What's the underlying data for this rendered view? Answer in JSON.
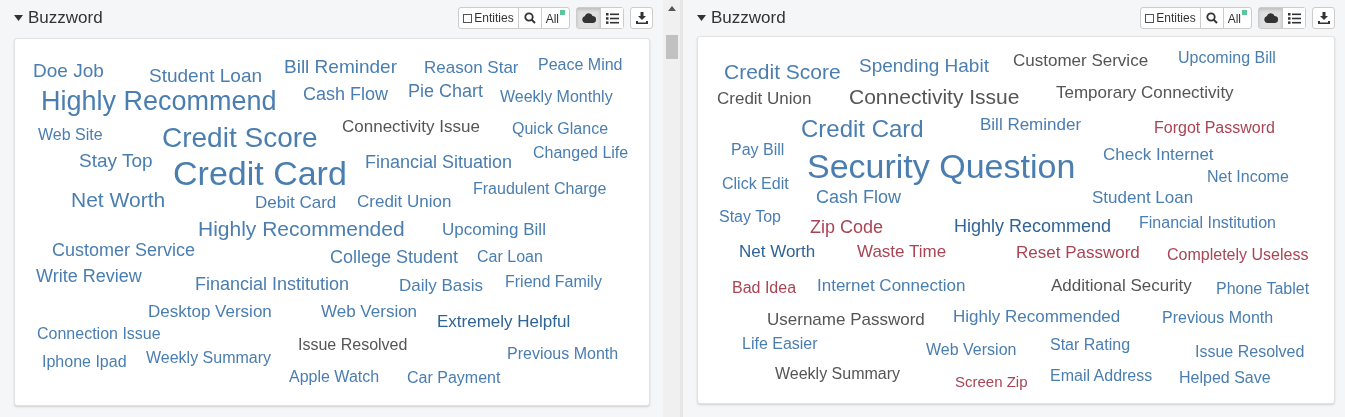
{
  "panels": [
    {
      "title": "Buzzword",
      "entities": {
        "label": "Entities",
        "checked": false
      },
      "scope": {
        "label": "All",
        "color": "#5cc59a"
      },
      "views": [
        {
          "kind": "cloud",
          "selected": true
        },
        {
          "kind": "list",
          "selected": false
        }
      ],
      "words": [
        {
          "text": "Doe Job",
          "color": "#4a7eb0"
        },
        {
          "text": "Student Loan",
          "color": "#4a7eb0"
        },
        {
          "text": "Bill Reminder",
          "color": "#4a7eb0"
        },
        {
          "text": "Reason Star",
          "color": "#4a7eb0"
        },
        {
          "text": "Peace Mind",
          "color": "#4a7eb0"
        },
        {
          "text": "Highly Recommend",
          "color": "#4a7eb0"
        },
        {
          "text": "Cash Flow",
          "color": "#4a7eb0"
        },
        {
          "text": "Pie Chart",
          "color": "#4a7eb0"
        },
        {
          "text": "Weekly Monthly",
          "color": "#4a7eb0"
        },
        {
          "text": "Web Site",
          "color": "#4a7eb0"
        },
        {
          "text": "Credit Score",
          "color": "#4a7eb0"
        },
        {
          "text": "Connectivity Issue",
          "color": "#555555"
        },
        {
          "text": "Quick Glance",
          "color": "#4a7eb0"
        },
        {
          "text": "Stay Top",
          "color": "#4a7eb0"
        },
        {
          "text": "Credit Card",
          "color": "#4a7eb0"
        },
        {
          "text": "Financial Situation",
          "color": "#4a7eb0"
        },
        {
          "text": "Changed Life",
          "color": "#4a7eb0"
        },
        {
          "text": "Net Worth",
          "color": "#4a7eb0"
        },
        {
          "text": "Debit Card",
          "color": "#4a7eb0"
        },
        {
          "text": "Credit Union",
          "color": "#4a7eb0"
        },
        {
          "text": "Fraudulent Charge",
          "color": "#4a7eb0"
        },
        {
          "text": "Highly Recommended",
          "color": "#4a7eb0"
        },
        {
          "text": "Upcoming Bill",
          "color": "#4a7eb0"
        },
        {
          "text": "Customer Service",
          "color": "#4a7eb0"
        },
        {
          "text": "College Student",
          "color": "#4a7eb0"
        },
        {
          "text": "Car Loan",
          "color": "#4a7eb0"
        },
        {
          "text": "Write Review",
          "color": "#4a7eb0"
        },
        {
          "text": "Financial Institution",
          "color": "#4a7eb0"
        },
        {
          "text": "Daily Basis",
          "color": "#4a7eb0"
        },
        {
          "text": "Friend Family",
          "color": "#4a7eb0"
        },
        {
          "text": "Desktop Version",
          "color": "#4a7eb0"
        },
        {
          "text": "Web Version",
          "color": "#4a7eb0"
        },
        {
          "text": "Extremely Helpful",
          "color": "#2f6496"
        },
        {
          "text": "Connection Issue",
          "color": "#4a7eb0"
        },
        {
          "text": "Issue Resolved",
          "color": "#555555"
        },
        {
          "text": "Previous Month",
          "color": "#4a7eb0"
        },
        {
          "text": "Iphone Ipad",
          "color": "#4a7eb0"
        },
        {
          "text": "Weekly Summary",
          "color": "#4a7eb0"
        },
        {
          "text": "Apple Watch",
          "color": "#4a7eb0"
        },
        {
          "text": "Car Payment",
          "color": "#4a7eb0"
        }
      ]
    },
    {
      "title": "Buzzword",
      "entities": {
        "label": "Entities",
        "checked": false
      },
      "scope": {
        "label": "All",
        "color": "#5cc59a"
      },
      "views": [
        {
          "kind": "cloud",
          "selected": true
        },
        {
          "kind": "list",
          "selected": false
        }
      ],
      "words": [
        {
          "text": "Credit Score",
          "color": "#4a7eb0"
        },
        {
          "text": "Spending Habit",
          "color": "#4a7eb0"
        },
        {
          "text": "Customer Service",
          "color": "#555555"
        },
        {
          "text": "Upcoming Bill",
          "color": "#4a7eb0"
        },
        {
          "text": "Credit Union",
          "color": "#555555"
        },
        {
          "text": "Connectivity Issue",
          "color": "#555555"
        },
        {
          "text": "Temporary Connectivity",
          "color": "#555555"
        },
        {
          "text": "Credit Card",
          "color": "#4a7eb0"
        },
        {
          "text": "Bill Reminder",
          "color": "#4a7eb0"
        },
        {
          "text": "Forgot Password",
          "color": "#a94455"
        },
        {
          "text": "Pay Bill",
          "color": "#4a7eb0"
        },
        {
          "text": "Security Question",
          "color": "#4a7eb0"
        },
        {
          "text": "Check Internet",
          "color": "#4a7eb0"
        },
        {
          "text": "Net Income",
          "color": "#4a7eb0"
        },
        {
          "text": "Click Edit",
          "color": "#4a7eb0"
        },
        {
          "text": "Cash Flow",
          "color": "#4a7eb0"
        },
        {
          "text": "Student Loan",
          "color": "#4a7eb0"
        },
        {
          "text": "Stay Top",
          "color": "#4a7eb0"
        },
        {
          "text": "Zip Code",
          "color": "#a94455"
        },
        {
          "text": "Highly Recommend",
          "color": "#2f6496"
        },
        {
          "text": "Financial Institution",
          "color": "#4a7eb0"
        },
        {
          "text": "Net Worth",
          "color": "#2f6496"
        },
        {
          "text": "Waste Time",
          "color": "#a94455"
        },
        {
          "text": "Reset Password",
          "color": "#a94455"
        },
        {
          "text": "Completely Useless",
          "color": "#a94455"
        },
        {
          "text": "Bad Idea",
          "color": "#a94455"
        },
        {
          "text": "Internet Connection",
          "color": "#4a7eb0"
        },
        {
          "text": "Additional Security",
          "color": "#555555"
        },
        {
          "text": "Phone Tablet",
          "color": "#4a7eb0"
        },
        {
          "text": "Username Password",
          "color": "#555555"
        },
        {
          "text": "Highly Recommended",
          "color": "#4a7eb0"
        },
        {
          "text": "Previous Month",
          "color": "#4a7eb0"
        },
        {
          "text": "Life Easier",
          "color": "#4a7eb0"
        },
        {
          "text": "Web Version",
          "color": "#4a7eb0"
        },
        {
          "text": "Star Rating",
          "color": "#4a7eb0"
        },
        {
          "text": "Issue Resolved",
          "color": "#4a7eb0"
        },
        {
          "text": "Weekly Summary",
          "color": "#555555"
        },
        {
          "text": "Screen Zip",
          "color": "#a94455"
        },
        {
          "text": "Email Address",
          "color": "#4a7eb0"
        },
        {
          "text": "Helped Save",
          "color": "#4a7eb0"
        }
      ]
    }
  ]
}
